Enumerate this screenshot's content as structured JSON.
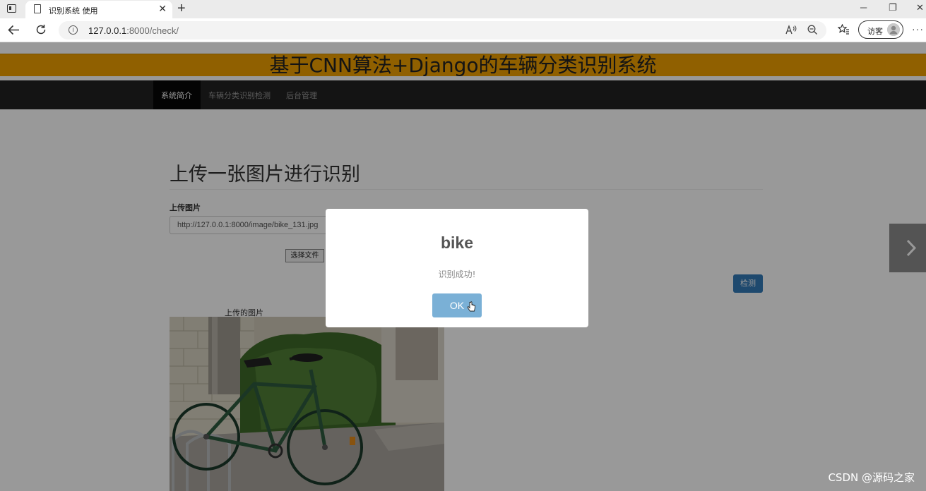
{
  "browser": {
    "tab_title": "识别系统 使用",
    "tab_close": "✕",
    "new_tab": "+",
    "url_host": "127.0.0.1",
    "url_path": ":8000/check/",
    "guest_label": "访客",
    "window_controls": [
      "─",
      "❐",
      "✕"
    ]
  },
  "site": {
    "banner_title": "基于CNN算法+Django的车辆分类识别系统",
    "nav": [
      "系统简介",
      "车辆分类识别检测",
      "后台管理"
    ]
  },
  "main": {
    "heading": "上传一张图片进行识别",
    "upload_label": "上传图片",
    "file_value": "http://127.0.0.1:8000/image/bike_131.jpg",
    "choose_file": "选择文件",
    "detect_button": "检测",
    "image_caption": "上传的图片"
  },
  "modal": {
    "title": "bike",
    "message": "识别成功!",
    "ok_label": "OK"
  },
  "watermark": "CSDN @源码之家",
  "colors": {
    "banner": "#f0a000",
    "navbar": "#222222",
    "primary": "#337ab7",
    "ok_button": "#7ab0d6"
  }
}
